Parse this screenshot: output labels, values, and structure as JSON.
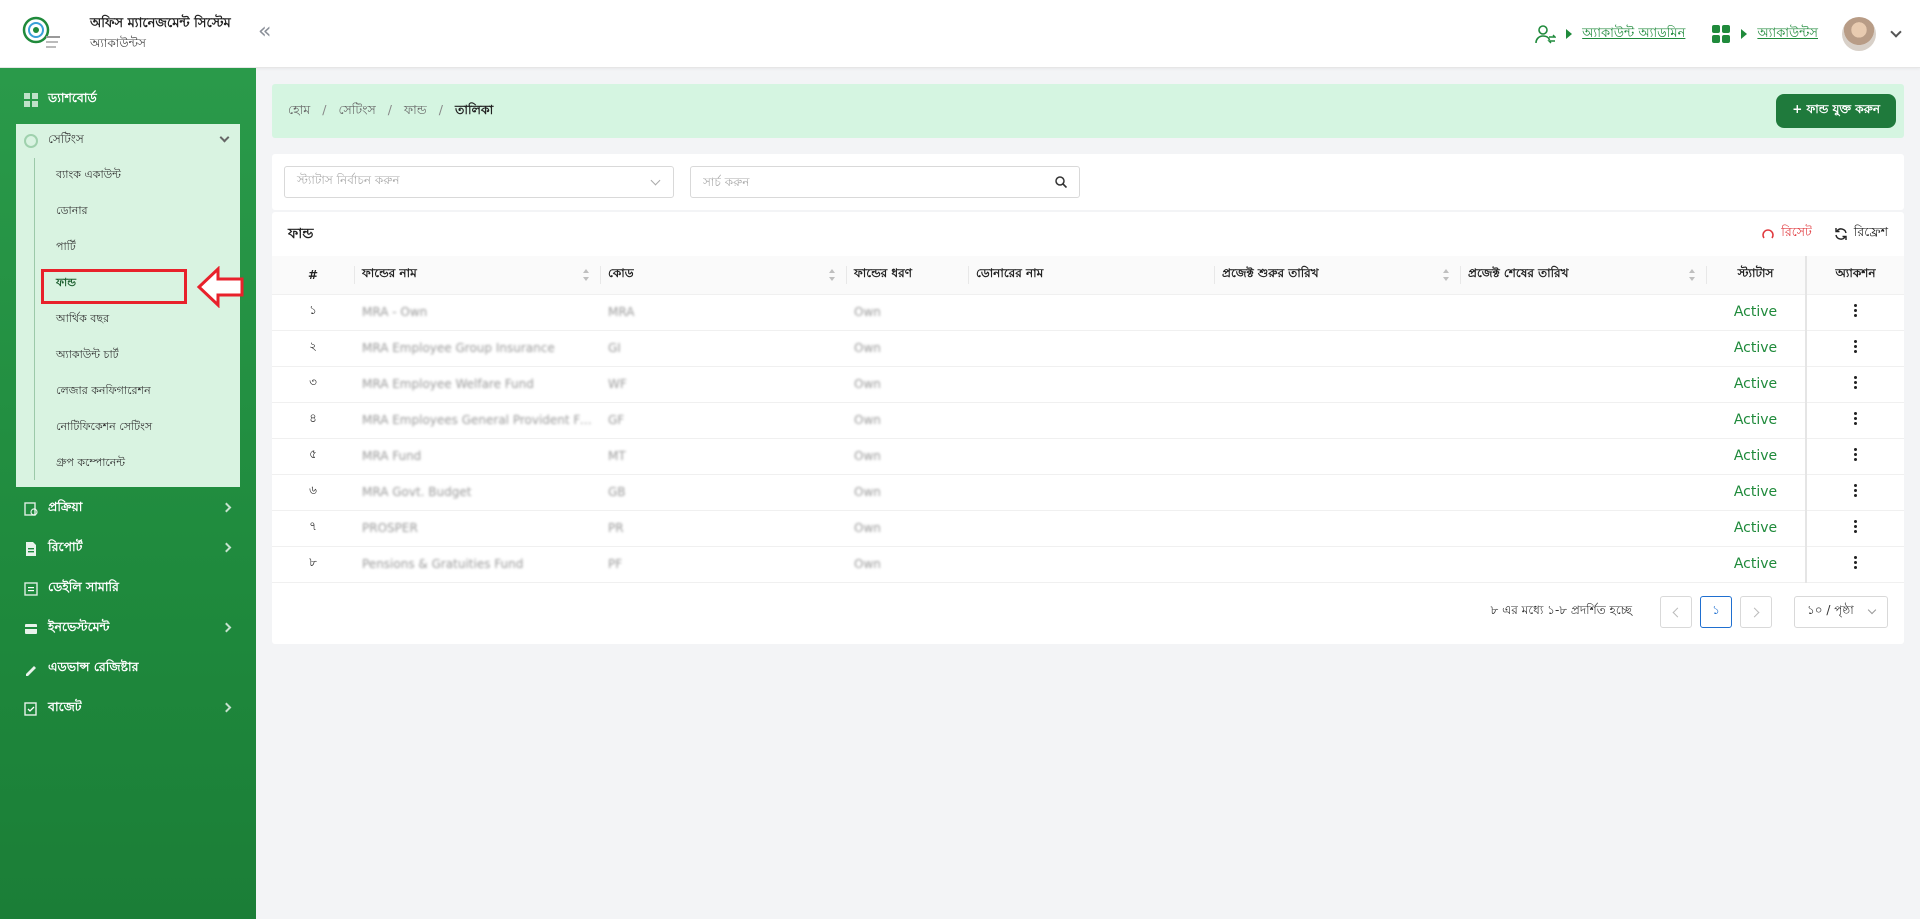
{
  "header": {
    "brand_title": "অফিস ম্যানেজমেন্ট সিস্টেম",
    "brand_subtitle": "অ্যাকাউন্টস",
    "collapse_icon": "double-chevron-left-icon",
    "user_switch_label": "অ্যাকাউন্ট অ্যাডমিন",
    "module_label": "অ্যাকাউন্টস",
    "accent_color": "#1f8a3b"
  },
  "sidebar": {
    "items": [
      {
        "label": "ড্যাশবোর্ড",
        "icon": "dashboard-icon"
      },
      {
        "label": "প্রক্রিয়া",
        "icon": "process-icon"
      },
      {
        "label": "রিপোর্ট",
        "icon": "report-icon"
      },
      {
        "label": "ডেইলি সামারি",
        "icon": "summary-icon"
      },
      {
        "label": "ইনভেস্টমেন্ট",
        "icon": "investment-icon"
      },
      {
        "label": "এডভান্স রেজিষ্টার",
        "icon": "register-icon"
      },
      {
        "label": "বাজেট",
        "icon": "budget-icon"
      }
    ],
    "settings": {
      "label": "সেটিংস",
      "sub_items": [
        "ব্যাংক একাউন্ট",
        "ডোনার",
        "পার্টি",
        "ফান্ড",
        "আর্থিক বছর",
        "অ্যাকাউন্ট চার্ট",
        "লেজার কনফিগারেশন",
        "নোটিফিকেশন সেটিংস",
        "গ্রুপ কম্পোনেন্ট"
      ],
      "active": "ফান্ড"
    }
  },
  "breadcrumb": [
    "হোম",
    "সেটিংস",
    "ফান্ড",
    "তালিকা"
  ],
  "add_button_label": "+ ফান্ড যুক্ত করুন",
  "filters": {
    "status_placeholder": "স্ট্যাটাস নির্বাচন করুন",
    "search_placeholder": "সার্চ করুন"
  },
  "table": {
    "title": "ফান্ড",
    "reset_label": "রিসেট",
    "refresh_label": "রিফ্রেশ",
    "columns": [
      "#",
      "ফান্ডের নাম",
      "কোড",
      "ফান্ডের ধরণ",
      "ডোনারের নাম",
      "প্রজেক্ট শুরুর তারিখ",
      "প্রজেক্ট শেষের তারিখ",
      "স্ট্যাটাস",
      "অ্যাকশন"
    ],
    "rows": [
      {
        "no": "১",
        "name": "MRA - Own",
        "code": "MRA",
        "type": "Own",
        "donor": "",
        "start": "",
        "end": "",
        "status": "Active"
      },
      {
        "no": "২",
        "name": "MRA Employee Group Insurance",
        "code": "GI",
        "type": "Own",
        "donor": "",
        "start": "",
        "end": "",
        "status": "Active"
      },
      {
        "no": "৩",
        "name": "MRA Employee Welfare Fund",
        "code": "WF",
        "type": "Own",
        "donor": "",
        "start": "",
        "end": "",
        "status": "Active"
      },
      {
        "no": "৪",
        "name": "MRA Employees General Provident Fund",
        "code": "GF",
        "type": "Own",
        "donor": "",
        "start": "",
        "end": "",
        "status": "Active"
      },
      {
        "no": "৫",
        "name": "MRA Fund",
        "code": "MT",
        "type": "Own",
        "donor": "",
        "start": "",
        "end": "",
        "status": "Active"
      },
      {
        "no": "৬",
        "name": "MRA Govt. Budget",
        "code": "GB",
        "type": "Own",
        "donor": "",
        "start": "",
        "end": "",
        "status": "Active"
      },
      {
        "no": "৭",
        "name": "PROSPER",
        "code": "PR",
        "type": "Own",
        "donor": "",
        "start": "",
        "end": "",
        "status": "Active"
      },
      {
        "no": "৮",
        "name": "Pensions & Gratuities Fund",
        "code": "PF",
        "type": "Own",
        "donor": "",
        "start": "",
        "end": "",
        "status": "Active"
      }
    ]
  },
  "pagination": {
    "info": "৮ এর মধ্যে ১-৮ প্রদর্শিত হচ্ছে",
    "current_page": "১",
    "page_size": "১০ / পৃষ্ঠা"
  },
  "status_color": "#1f8a3b"
}
